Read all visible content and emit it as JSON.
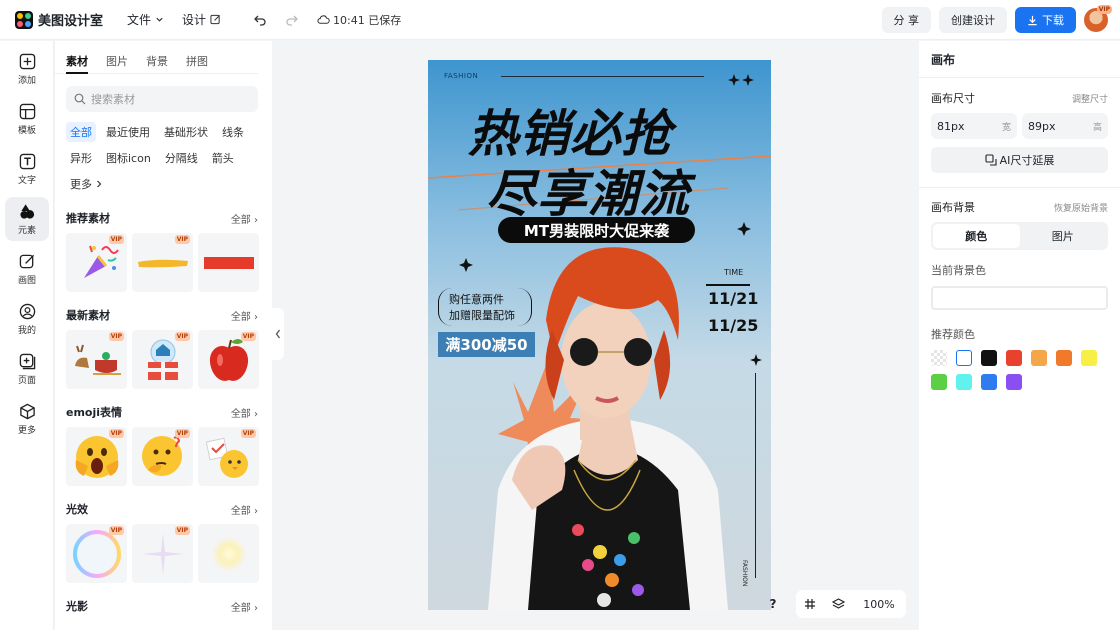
{
  "app": {
    "name": "美图设计室"
  },
  "topbar": {
    "menu_file": "文件",
    "menu_design": "设计",
    "saved_status": "10:41 已保存",
    "share": "分 享",
    "create": "创建设计",
    "download": "下载",
    "avatar_badge": "VIP"
  },
  "leftnav": {
    "items": [
      {
        "label": "添加",
        "icon": "plus-square-icon"
      },
      {
        "label": "模板",
        "icon": "template-icon"
      },
      {
        "label": "文字",
        "icon": "text-icon"
      },
      {
        "label": "元素",
        "icon": "shapes-icon"
      },
      {
        "label": "画图",
        "icon": "edit-icon"
      },
      {
        "label": "我的",
        "icon": "user-icon"
      },
      {
        "label": "页面",
        "icon": "page-add-icon"
      },
      {
        "label": "更多",
        "icon": "cube-icon"
      }
    ],
    "active": "元素"
  },
  "panel": {
    "tabs": [
      "素材",
      "图片",
      "背景",
      "拼图"
    ],
    "active_tab": "素材",
    "search_placeholder": "搜索素材",
    "categories": [
      "全部",
      "最近使用",
      "基础形状",
      "线条",
      "异形",
      "图标icon",
      "分隔线",
      "箭头",
      "更多"
    ],
    "active_category": "全部",
    "all_label": "全部",
    "vip_label": "VIP",
    "sections": [
      {
        "title": "推荐素材",
        "items": [
          "party-popper",
          "yellow-brush-stroke",
          "red-bar"
        ]
      },
      {
        "title": "最新素材",
        "items": [
          "reindeer-sleigh",
          "snow-globe-gift",
          "red-apple"
        ]
      },
      {
        "title": "emoji表情",
        "items": [
          "shocked-face",
          "thinking-face",
          "chick-with-sign"
        ]
      },
      {
        "title": "光效",
        "items": [
          "rainbow-bubble",
          "sparkle",
          "glow"
        ]
      },
      {
        "title": "光影",
        "items": []
      }
    ]
  },
  "poster": {
    "fashion_top": "FASHION",
    "headline_1": "热销必抢",
    "headline_2": "尽享潮流",
    "pill": "MT男装限时大促来袭",
    "time_label": "TIME",
    "date_start": "11/21",
    "date_end": "11/25",
    "buy_line1": "购任意两件",
    "buy_line2": "加赠限量配饰",
    "deal": "满300减50",
    "fashion_side": "FASHION"
  },
  "bottom_tools": {
    "help": "?",
    "zoom": "100%"
  },
  "right_panel": {
    "title": "画布",
    "canvas_size_label": "画布尺寸",
    "adjust_size": "调整尺寸",
    "width_value": "81px",
    "width_unit": "宽",
    "height_value": "89px",
    "height_unit": "高",
    "ai_expand": "AI尺寸延展",
    "bg_label": "画布背景",
    "reset_bg": "恢复原始背景",
    "seg_color": "颜色",
    "seg_image": "图片",
    "current_bg": "当前背景色",
    "recommended": "推荐颜色",
    "swatches": [
      "transparent",
      "#ffffff",
      "#111111",
      "#e8412c",
      "#f4a64a",
      "#f07a2a",
      "#f7ef45",
      "#5ccf45",
      "#5ff2ee",
      "#2f7cf0",
      "#8a4ff0"
    ]
  }
}
